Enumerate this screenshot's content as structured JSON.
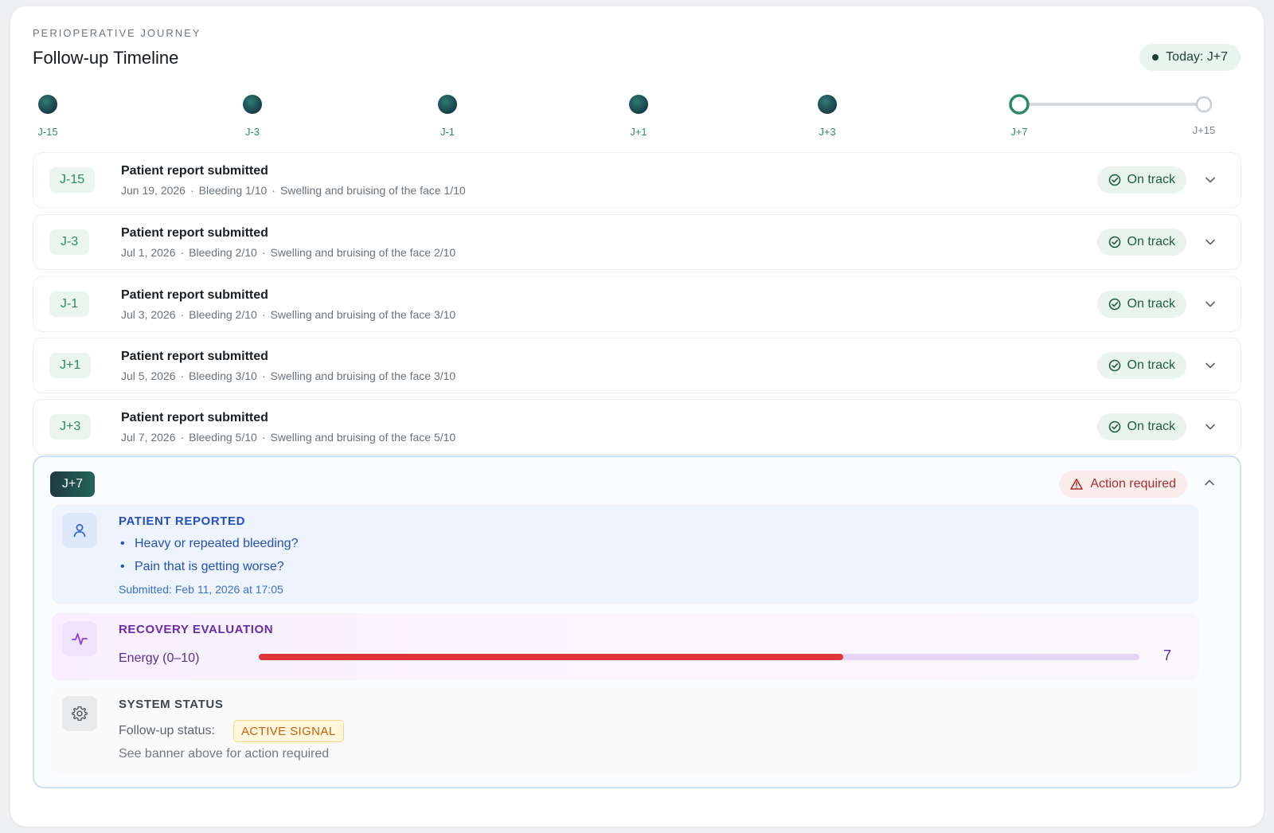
{
  "header": {
    "eyebrow": "PERIOPERATIVE JOURNEY",
    "title": "Follow-up Timeline",
    "today_label": "Today: J+7"
  },
  "timeline": {
    "points": [
      {
        "label": "J-15",
        "state": "done"
      },
      {
        "label": "J-3",
        "state": "done"
      },
      {
        "label": "J-1",
        "state": "done"
      },
      {
        "label": "J+1",
        "state": "done"
      },
      {
        "label": "J+3",
        "state": "done"
      },
      {
        "label": "J+7",
        "state": "current"
      },
      {
        "label": "J+15",
        "state": "future"
      }
    ]
  },
  "reports": [
    {
      "day": "J-15",
      "title": "Patient report submitted",
      "date": "Jun 19, 2026",
      "bleeding": "Bleeding 1/10",
      "swelling": "Swelling and bruising of the face 1/10",
      "status": "On track"
    },
    {
      "day": "J-3",
      "title": "Patient report submitted",
      "date": "Jul 1, 2026",
      "bleeding": "Bleeding 2/10",
      "swelling": "Swelling and bruising of the face 2/10",
      "status": "On track"
    },
    {
      "day": "J-1",
      "title": "Patient report submitted",
      "date": "Jul 3, 2026",
      "bleeding": "Bleeding 2/10",
      "swelling": "Swelling and bruising of the face 3/10",
      "status": "On track"
    },
    {
      "day": "J+1",
      "title": "Patient report submitted",
      "date": "Jul 5, 2026",
      "bleeding": "Bleeding 3/10",
      "swelling": "Swelling and bruising of the face 3/10",
      "status": "On track"
    },
    {
      "day": "J+3",
      "title": "Patient report submitted",
      "date": "Jul 7, 2026",
      "bleeding": "Bleeding 5/10",
      "swelling": "Swelling and bruising of the face 5/10",
      "status": "On track"
    }
  ],
  "expanded": {
    "day": "J+7",
    "status": "Action required",
    "patient": {
      "title": "PATIENT REPORTED",
      "bullets": [
        "Heavy or repeated bleeding?",
        "Pain that is getting worse?"
      ],
      "submitted": "Submitted: Feb 11, 2026 at 17:05"
    },
    "recovery": {
      "title": "RECOVERY EVALUATION",
      "metric_label": "Energy (0–10)",
      "value": "7",
      "bar_fraction": 0.664
    },
    "system": {
      "title": "SYSTEM STATUS",
      "followup_label": "Follow-up status:",
      "badge": "ACTIVE SIGNAL",
      "note": "See banner above for action required"
    }
  },
  "colors": {
    "accent_green": "#2d8a62",
    "alert_red": "#a82f2f",
    "bar_red": "#df3539",
    "dark_teal": "#1e3a40"
  }
}
